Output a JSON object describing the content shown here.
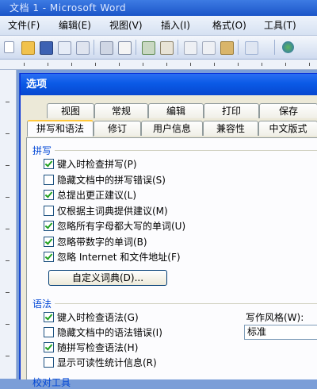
{
  "window": {
    "title": "文档 1 - Microsoft Word"
  },
  "menubar": {
    "items": [
      "文件(F)",
      "编辑(E)",
      "视图(V)",
      "插入(I)",
      "格式(O)",
      "工具(T)"
    ]
  },
  "dialog": {
    "title": "选项",
    "tabs_row1": [
      "视图",
      "常规",
      "编辑",
      "打印",
      "保存"
    ],
    "tabs_row2": [
      "拼写和语法",
      "修订",
      "用户信息",
      "兼容性",
      "中文版式"
    ],
    "active_tab": "拼写和语法",
    "spelling": {
      "label": "拼写",
      "options": [
        {
          "label": "键入时检查拼写(P)",
          "checked": true
        },
        {
          "label": "隐藏文档中的拼写错误(S)",
          "checked": false
        },
        {
          "label": "总提出更正建议(L)",
          "checked": true
        },
        {
          "label": "仅根据主词典提供建议(M)",
          "checked": false
        },
        {
          "label": "忽略所有字母都大写的单词(U)",
          "checked": true
        },
        {
          "label": "忽略带数字的单词(B)",
          "checked": true
        },
        {
          "label": "忽略 Internet 和文件地址(F)",
          "checked": true
        }
      ],
      "custom_dict_button": "自定义词典(D)..."
    },
    "grammar": {
      "label": "语法",
      "options": [
        {
          "label": "键入时检查语法(G)",
          "checked": true
        },
        {
          "label": "隐藏文档中的语法错误(I)",
          "checked": false
        },
        {
          "label": "随拼写检查语法(H)",
          "checked": true
        },
        {
          "label": "显示可读性统计信息(R)",
          "checked": false
        }
      ],
      "writing_style_label": "写作风格(W):",
      "writing_style_value": "标准"
    },
    "proofing_tools_label": "校对工具"
  }
}
